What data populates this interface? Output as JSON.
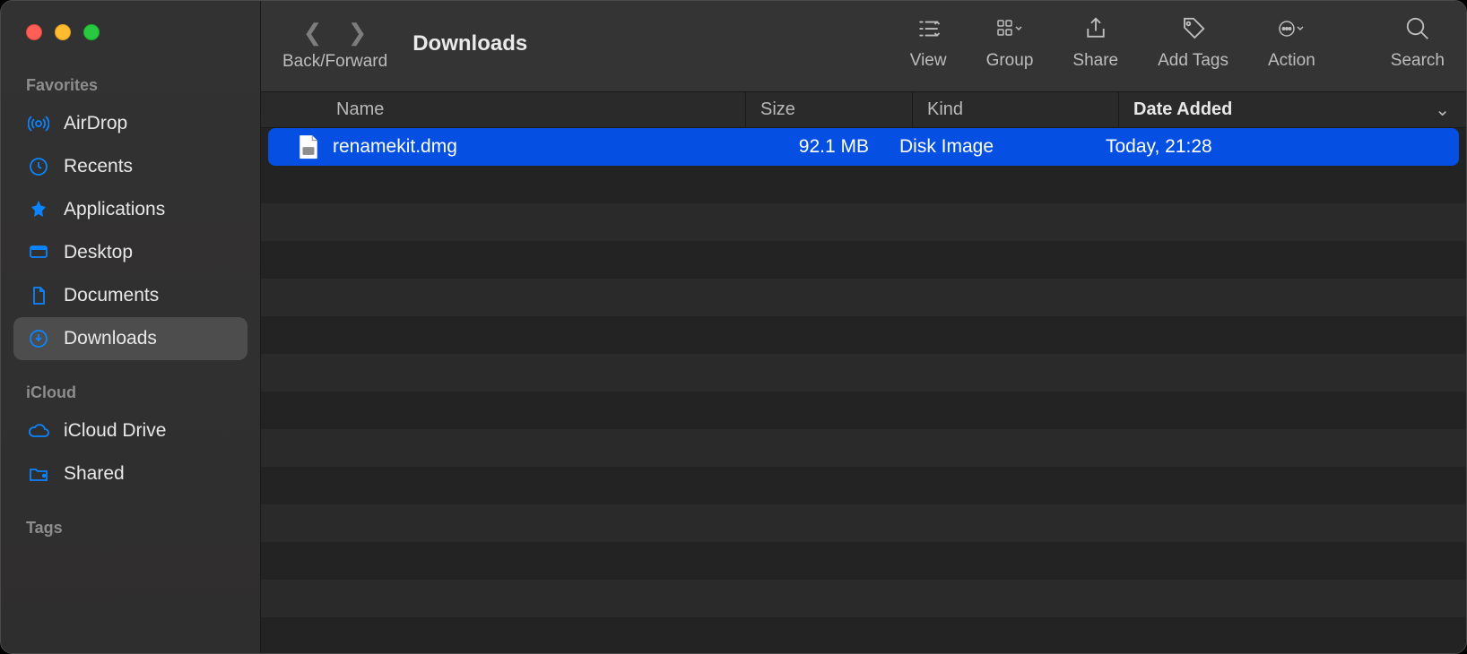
{
  "window_title": "Downloads",
  "traffic_lights": {
    "close": "#ff5f57",
    "minimize": "#febc2e",
    "zoom": "#28c840"
  },
  "nav_label": "Back/Forward",
  "toolbar": {
    "view_label": "View",
    "group_label": "Group",
    "share_label": "Share",
    "tags_label": "Add Tags",
    "action_label": "Action",
    "search_label": "Search"
  },
  "sidebar": {
    "sections": [
      {
        "heading": "Favorites",
        "items": [
          {
            "label": "AirDrop",
            "icon": "airdrop"
          },
          {
            "label": "Recents",
            "icon": "recents"
          },
          {
            "label": "Applications",
            "icon": "applications"
          },
          {
            "label": "Desktop",
            "icon": "desktop"
          },
          {
            "label": "Documents",
            "icon": "documents"
          },
          {
            "label": "Downloads",
            "icon": "downloads",
            "active": true
          }
        ]
      },
      {
        "heading": "iCloud",
        "items": [
          {
            "label": "iCloud Drive",
            "icon": "icloud"
          },
          {
            "label": "Shared",
            "icon": "shared"
          }
        ]
      },
      {
        "heading": "Tags",
        "items": []
      }
    ]
  },
  "columns": {
    "name": "Name",
    "size": "Size",
    "kind": "Kind",
    "date_added": "Date Added"
  },
  "files": [
    {
      "name": "renamekit.dmg",
      "size": "92.1 MB",
      "kind": "Disk Image",
      "date_added": "Today, 21:28",
      "selected": true
    }
  ]
}
